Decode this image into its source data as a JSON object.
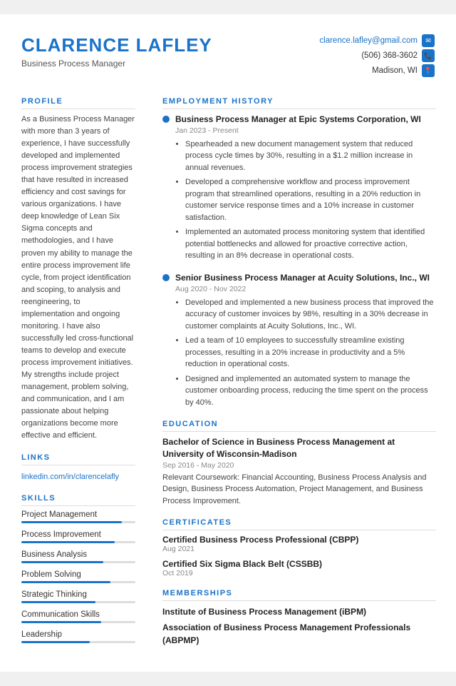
{
  "header": {
    "name": "CLARENCE LAFLEY",
    "title": "Business Process Manager",
    "email": "clarence.lafley@gmail.com",
    "phone": "(506) 368-3602",
    "location": "Madison, WI"
  },
  "profile": {
    "section_title": "PROFILE",
    "text": "As a Business Process Manager with more than 3 years of experience, I have successfully developed and implemented process improvement strategies that have resulted in increased efficiency and cost savings for various organizations. I have deep knowledge of Lean Six Sigma concepts and methodologies, and I have proven my ability to manage the entire process improvement life cycle, from project identification and scoping, to analysis and reengineering, to implementation and ongoing monitoring. I have also successfully led cross-functional teams to develop and execute process improvement initiatives. My strengths include project management, problem solving, and communication, and I am passionate about helping organizations become more effective and efficient."
  },
  "links": {
    "section_title": "LINKS",
    "linkedin": "linkedin.com/in/clarencelafly"
  },
  "skills": {
    "section_title": "SKILLS",
    "items": [
      {
        "name": "Project Management",
        "level": 88
      },
      {
        "name": "Process Improvement",
        "level": 82
      },
      {
        "name": "Business Analysis",
        "level": 72
      },
      {
        "name": "Problem Solving",
        "level": 78
      },
      {
        "name": "Strategic Thinking",
        "level": 65
      },
      {
        "name": "Communication Skills",
        "level": 70
      },
      {
        "name": "Leadership",
        "level": 60
      }
    ]
  },
  "employment": {
    "section_title": "EMPLOYMENT HISTORY",
    "jobs": [
      {
        "title": "Business Process Manager at Epic Systems Corporation, WI",
        "dates": "Jan 2023 - Present",
        "bullets": [
          "Spearheaded a new document management system that reduced process cycle times by 30%, resulting in a $1.2 million increase in annual revenues.",
          "Developed a comprehensive workflow and process improvement program that streamlined operations, resulting in a 20% reduction in customer service response times and a 10% increase in customer satisfaction.",
          "Implemented an automated process monitoring system that identified potential bottlenecks and allowed for proactive corrective action, resulting in an 8% decrease in operational costs."
        ]
      },
      {
        "title": "Senior Business Process Manager at Acuity Solutions, Inc., WI",
        "dates": "Aug 2020 - Nov 2022",
        "bullets": [
          "Developed and implemented a new business process that improved the accuracy of customer invoices by 98%, resulting in a 30% decrease in customer complaints at Acuity Solutions, Inc., WI.",
          "Led a team of 10 employees to successfully streamline existing processes, resulting in a 20% increase in productivity and a 5% reduction in operational costs.",
          "Designed and implemented an automated system to manage the customer onboarding process, reducing the time spent on the process by 40%."
        ]
      }
    ]
  },
  "education": {
    "section_title": "EDUCATION",
    "degree": "Bachelor of Science in Business Process Management at University of Wisconsin-Madison",
    "dates": "Sep 2016 - May 2020",
    "description": "Relevant Coursework: Financial Accounting, Business Process Analysis and Design, Business Process Automation, Project Management, and Business Process Improvement."
  },
  "certificates": {
    "section_title": "CERTIFICATES",
    "items": [
      {
        "name": "Certified Business Process Professional (CBPP)",
        "date": "Aug 2021"
      },
      {
        "name": "Certified Six Sigma Black Belt (CSSBB)",
        "date": "Oct 2019"
      }
    ]
  },
  "memberships": {
    "section_title": "MEMBERSHIPS",
    "items": [
      "Institute of Business Process Management (iBPM)",
      "Association of Business Process Management Professionals (ABPMP)"
    ]
  }
}
